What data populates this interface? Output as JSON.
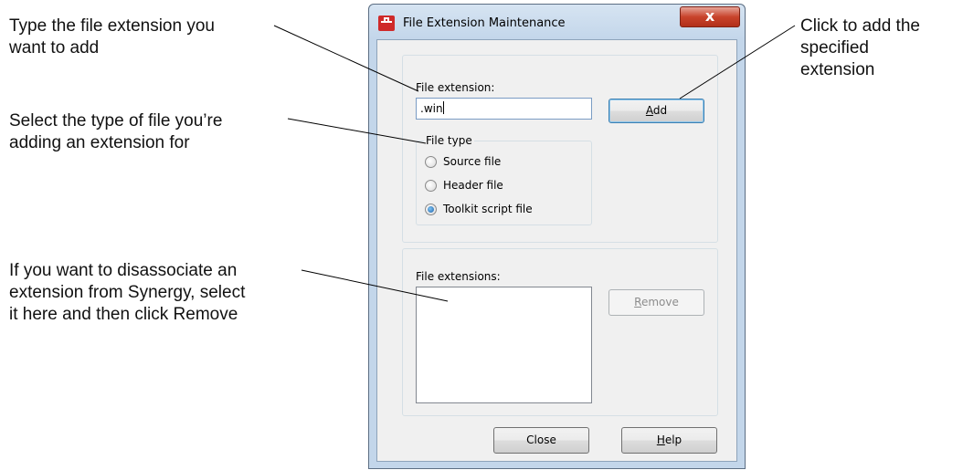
{
  "callouts": {
    "left_1": [
      "Type the file extension you",
      "want to add"
    ],
    "left_2": [
      "Select the type of file you’re",
      "adding an extension for"
    ],
    "left_3": [
      "If you want to disassociate an",
      "extension from Synergy, select",
      "it here and then click Remove"
    ],
    "right_1": [
      "Click to add the",
      "specified",
      "extension"
    ]
  },
  "window": {
    "title": "File Extension Maintenance",
    "close_glyph": "x"
  },
  "add_group": {
    "extension_label": "File extension:",
    "extension_value": ".win",
    "add_button": {
      "pre": "",
      "accel": "A",
      "post": "dd"
    },
    "file_type": {
      "legend": "File type",
      "options": [
        {
          "label": "Source file",
          "checked": false
        },
        {
          "label": "Header file",
          "checked": false
        },
        {
          "label": "Toolkit script file",
          "checked": true
        }
      ]
    }
  },
  "remove_group": {
    "list_label": "File extensions:",
    "items": [],
    "remove_button": {
      "pre": "",
      "accel": "R",
      "post": "emove",
      "enabled": false
    }
  },
  "footer": {
    "close_button": "Close",
    "help_button": {
      "pre": "",
      "accel": "H",
      "post": "elp"
    }
  },
  "colors": {
    "frame": "#c3d6ea",
    "close_red": "#c8432b",
    "default_button_border": "#3c7fb1"
  }
}
